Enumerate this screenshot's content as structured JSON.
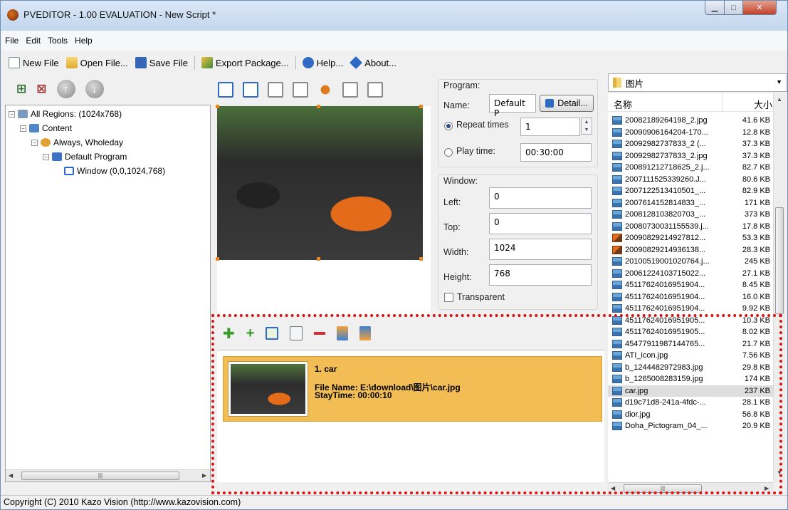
{
  "window": {
    "title": "PVEDITOR - 1.00 EVALUATION - New Script *"
  },
  "menu": [
    "File",
    "Edit",
    "Tools",
    "Help"
  ],
  "toolbar": {
    "new_file": "New File",
    "open_file": "Open File...",
    "save_file": "Save File",
    "export_package": "Export Package...",
    "help": "Help...",
    "about": "About..."
  },
  "tree": {
    "root": "All Regions: (1024x768)",
    "content": "Content",
    "schedule": "Always, Wholeday",
    "program": "Default Program",
    "window": "Window (0,0,1024,768)"
  },
  "program": {
    "section_label": "Program:",
    "name_label": "Name:",
    "name_value": "Default P",
    "detail_button": "Detail...",
    "repeat_label": "Repeat times",
    "repeat_value": "1",
    "playtime_label": "Play time:",
    "playtime_value": "00:30:00",
    "repeat_selected": true
  },
  "window_props": {
    "section_label": "Window:",
    "left_label": "Left:",
    "left_value": "0",
    "top_label": "Top:",
    "top_value": "0",
    "width_label": "Width:",
    "width_value": "1024",
    "height_label": "Height:",
    "height_value": "768",
    "transparent_label": "Transparent",
    "transparent_checked": false
  },
  "playlist": {
    "items": [
      {
        "title": "1. car",
        "file_name": "File Name: E:\\download\\图片\\car.jpg",
        "stay_time": "StayTime: 00:00:10"
      }
    ]
  },
  "file_browser": {
    "folder": "图片",
    "col_name": "名称",
    "col_size": "大小",
    "files": [
      {
        "name": "20082189264198_2.jpg",
        "size": "41.6 KB",
        "icon": "image-icon"
      },
      {
        "name": "20090906164204-170...",
        "size": "12.8 KB",
        "icon": "image-icon"
      },
      {
        "name": "20092982737833_2 (...",
        "size": "37.3 KB",
        "icon": "image-icon"
      },
      {
        "name": "20092982737833_2.jpg",
        "size": "37.3 KB",
        "icon": "image-icon"
      },
      {
        "name": "200891212718625_2.j...",
        "size": "82.7 KB",
        "icon": "image-icon"
      },
      {
        "name": "2007111525339260.J...",
        "size": "80.6 KB",
        "icon": "image-icon"
      },
      {
        "name": "2007122513410501_...",
        "size": "82.9 KB",
        "icon": "image-icon"
      },
      {
        "name": "2007614152814833_...",
        "size": "171 KB",
        "icon": "image-icon"
      },
      {
        "name": "2008128103820703_...",
        "size": "373 KB",
        "icon": "image-icon"
      },
      {
        "name": "20080730031155539.j...",
        "size": "17.8 KB",
        "icon": "image-icon"
      },
      {
        "name": "20090829214927812...",
        "size": "53.3 KB",
        "icon": "paint-icon"
      },
      {
        "name": "20090829214936138...",
        "size": "28.3 KB",
        "icon": "paint-icon"
      },
      {
        "name": "20100519001020764.j...",
        "size": "245 KB",
        "icon": "image-icon"
      },
      {
        "name": "20061224103715022...",
        "size": "27.1 KB",
        "icon": "image-icon"
      },
      {
        "name": "45117624016951904...",
        "size": "8.45 KB",
        "icon": "image-icon"
      },
      {
        "name": "45117624016951904...",
        "size": "16.0 KB",
        "icon": "image-icon"
      },
      {
        "name": "45117624016951904...",
        "size": "9.92 KB",
        "icon": "image-icon"
      },
      {
        "name": "45117624016951905...",
        "size": "10.3 KB",
        "icon": "image-icon"
      },
      {
        "name": "45117624016951905...",
        "size": "8.02 KB",
        "icon": "image-icon"
      },
      {
        "name": "45477911987144765...",
        "size": "21.7 KB",
        "icon": "image-icon"
      },
      {
        "name": "ATI_icon.jpg",
        "size": "7.56 KB",
        "icon": "image-icon"
      },
      {
        "name": "b_1244482972983.jpg",
        "size": "29.8 KB",
        "icon": "image-icon"
      },
      {
        "name": "b_1265008283159.jpg",
        "size": "174 KB",
        "icon": "image-icon"
      },
      {
        "name": "car.jpg",
        "size": "237 KB",
        "icon": "image-icon",
        "selected": true
      },
      {
        "name": "d19c71d8-241a-4fdc-...",
        "size": "28.1 KB",
        "icon": "image-icon"
      },
      {
        "name": "dior.jpg",
        "size": "56.8 KB",
        "icon": "image-icon"
      },
      {
        "name": "Doha_Pictogram_04_...",
        "size": "20.9 KB",
        "icon": "image-icon"
      }
    ]
  },
  "statusbar": {
    "text": "Copyright (C) 2010 Kazo Vision (http://www.kazovision.com)"
  }
}
